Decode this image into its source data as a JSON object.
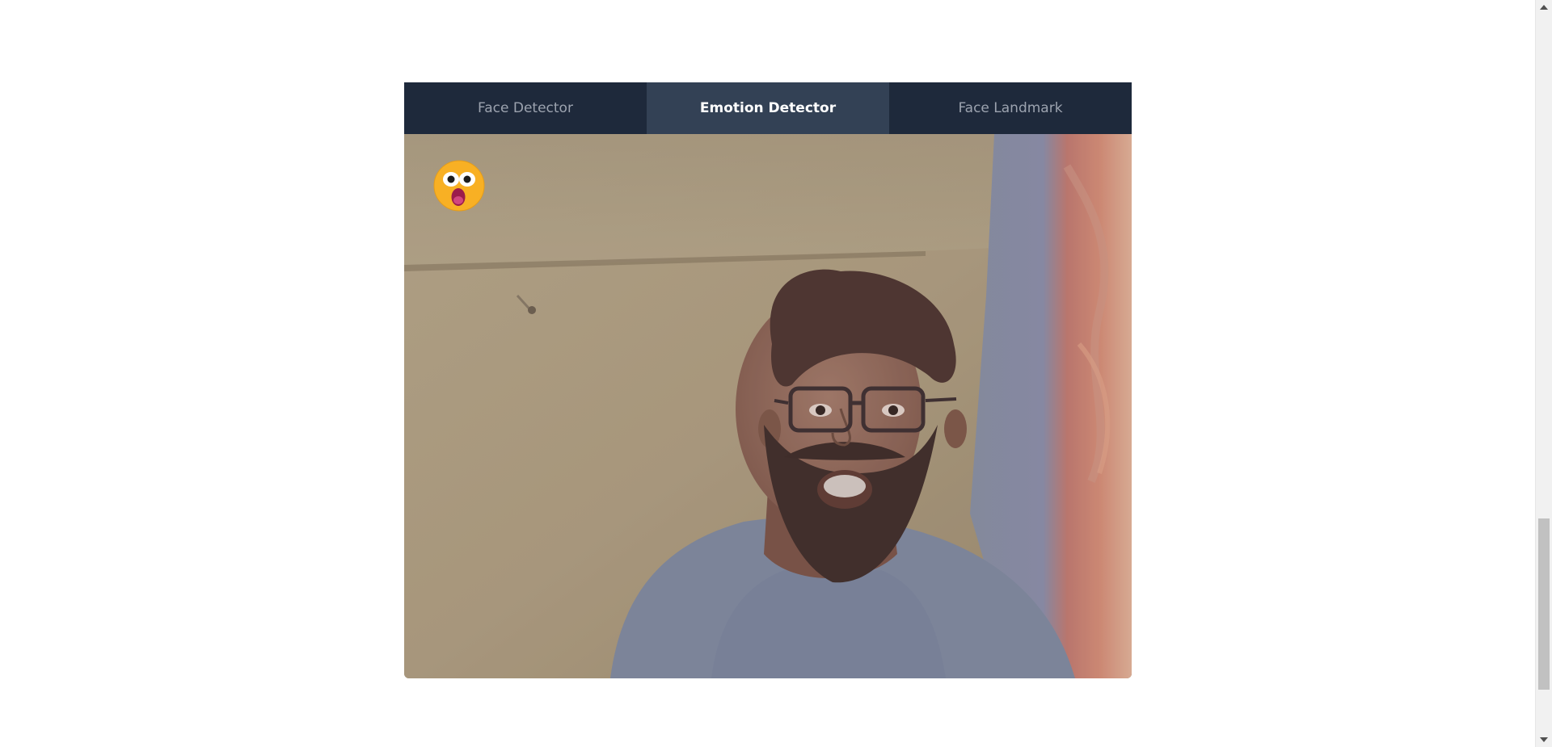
{
  "tabs": [
    {
      "label": "Face Detector",
      "active": false
    },
    {
      "label": "Emotion Detector",
      "active": true
    },
    {
      "label": "Face Landmark",
      "active": false
    }
  ],
  "video": {
    "detected_emotion_icon": "surprised-face-emoji"
  },
  "colors": {
    "tab_bar_bg": "#1e293b",
    "tab_active_bg": "#334155",
    "tab_inactive_text": "#9ca3af",
    "tab_active_text": "#ffffff",
    "emoji_yellow": "#f8b024"
  }
}
